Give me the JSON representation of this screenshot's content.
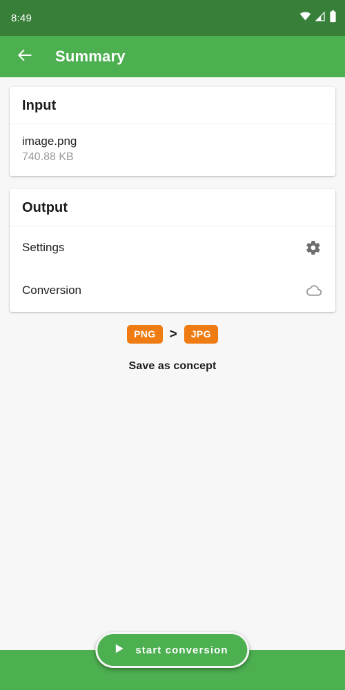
{
  "status_bar": {
    "time": "8:49",
    "icons": [
      "wifi-icon",
      "cellular-signal-icon",
      "battery-icon"
    ],
    "background": "#38803a"
  },
  "app_bar": {
    "back_icon": "arrow-left-icon",
    "title": "Summary",
    "background": "#4caf50"
  },
  "input_card": {
    "header": "Input",
    "file_name": "image.png",
    "file_size": "740.88 KB"
  },
  "output_card": {
    "header": "Output",
    "rows": [
      {
        "label": "Settings",
        "icon": "gear-icon"
      },
      {
        "label": "Conversion",
        "icon": "cloud-icon"
      }
    ]
  },
  "formats": {
    "source": "PNG",
    "separator": ">",
    "target": "JPG",
    "badge_color": "#ef7c12"
  },
  "save_as_concept": "Save as concept",
  "fab": {
    "icon": "play-icon",
    "label": "start conversion",
    "background": "#4caf50"
  },
  "colors": {
    "page_background": "#f7f7f7",
    "card_background": "#ffffff",
    "primary_green": "#4caf50",
    "dark_green": "#38803a",
    "accent_orange": "#ef7c12",
    "muted_text": "#9a9a9a"
  }
}
